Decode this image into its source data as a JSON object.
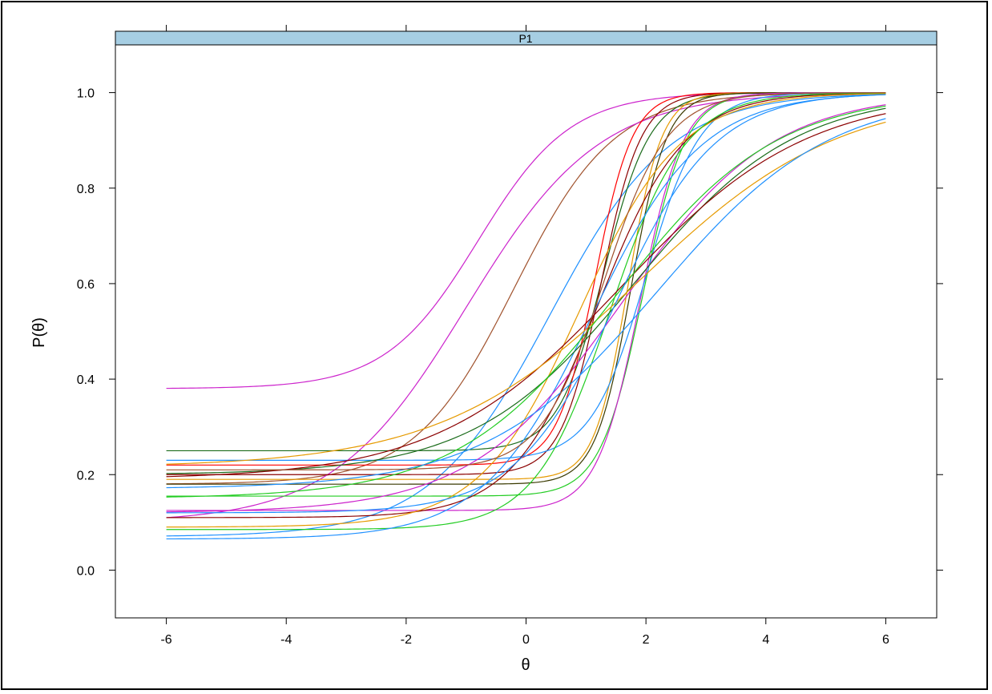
{
  "chart_data": {
    "type": "line",
    "title": "",
    "panel_label": "P1",
    "xlabel": "θ",
    "ylabel": "P(θ)",
    "xlim": [
      -6.85,
      6.85
    ],
    "ylim": [
      -0.1,
      1.1
    ],
    "x_ticks": [
      -6,
      -4,
      -2,
      0,
      2,
      4,
      6
    ],
    "y_ticks": [
      0.0,
      0.2,
      0.4,
      0.6,
      0.8,
      1.0
    ],
    "x_tick_labels": [
      "-6",
      "-4",
      "-2",
      "0",
      "2",
      "4",
      "6"
    ],
    "y_tick_labels": [
      "0.0",
      "0.2",
      "0.4",
      "0.6",
      "0.8",
      "1.0"
    ],
    "grid": false,
    "legend": "none",
    "model": "P(θ) = c + (1 − c) / (1 + exp(−a(θ − b)))",
    "x_range": [
      -6,
      6
    ],
    "series": [
      {
        "a": 1.3,
        "b": -0.8,
        "c": 0.38,
        "color": "#cc22cc"
      },
      {
        "a": 1.2,
        "b": -0.2,
        "c": 0.18,
        "color": "#a0522d"
      },
      {
        "a": 0.9,
        "b": -1.0,
        "c": 0.1,
        "color": "#cc22cc"
      },
      {
        "a": 1.0,
        "b": 0.4,
        "c": 0.07,
        "color": "#1e90ff"
      },
      {
        "a": 2.6,
        "b": 1.3,
        "c": 0.25,
        "color": "#1a6b1a"
      },
      {
        "a": 3.2,
        "b": 1.15,
        "c": 0.22,
        "color": "#ff0000"
      },
      {
        "a": 3.0,
        "b": 1.25,
        "c": 0.2,
        "color": "#8b0000"
      },
      {
        "a": 3.6,
        "b": 1.7,
        "c": 0.19,
        "color": "#e69a00"
      },
      {
        "a": 3.4,
        "b": 1.75,
        "c": 0.18,
        "color": "#3a3a00"
      },
      {
        "a": 2.8,
        "b": 1.95,
        "c": 0.155,
        "color": "#22cc22"
      },
      {
        "a": 2.8,
        "b": 1.9,
        "c": 0.125,
        "color": "#cc22cc"
      },
      {
        "a": 2.2,
        "b": 2.0,
        "c": 0.23,
        "color": "#1e90ff"
      },
      {
        "a": 1.4,
        "b": 1.2,
        "c": 0.11,
        "color": "#8b0000"
      },
      {
        "a": 1.2,
        "b": 0.9,
        "c": 0.09,
        "color": "#e69a00"
      },
      {
        "a": 1.6,
        "b": 1.4,
        "c": 0.085,
        "color": "#22cc22"
      },
      {
        "a": 1.1,
        "b": 1.1,
        "c": 0.065,
        "color": "#1e90ff"
      },
      {
        "a": 0.8,
        "b": 1.6,
        "c": 0.12,
        "color": "#cc22cc"
      },
      {
        "a": 0.75,
        "b": 1.8,
        "c": 0.2,
        "color": "#1a6b1a"
      },
      {
        "a": 0.65,
        "b": 1.6,
        "c": 0.19,
        "color": "#8b0000"
      },
      {
        "a": 0.6,
        "b": 1.9,
        "c": 0.215,
        "color": "#e69a00"
      },
      {
        "a": 0.75,
        "b": 1.5,
        "c": 0.15,
        "color": "#22cc22"
      },
      {
        "a": 1.2,
        "b": 1.5,
        "c": 0.12,
        "color": "#1e90ff"
      },
      {
        "a": 0.7,
        "b": 2.2,
        "c": 0.17,
        "color": "#1e90ff"
      },
      {
        "a": 1.9,
        "b": 1.3,
        "c": 0.21,
        "color": "#a0522d"
      }
    ]
  }
}
